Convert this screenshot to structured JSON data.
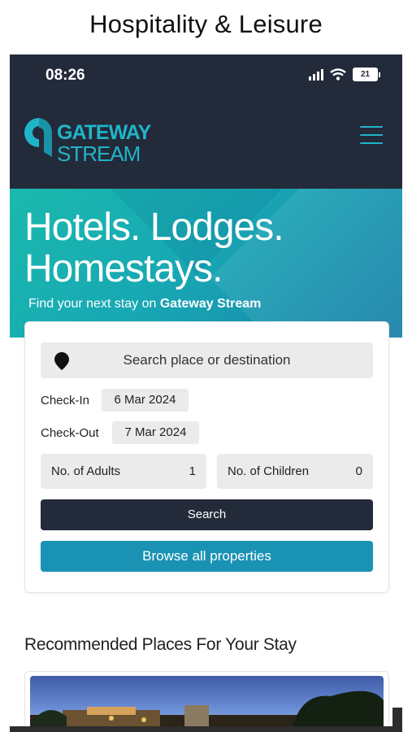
{
  "page_heading": "Hospitality & Leisure",
  "status_bar": {
    "time": "08:26",
    "battery": "21"
  },
  "brand": {
    "logo_line1": "GATEWAY",
    "logo_line2": "STREAM",
    "accent": "#1fb5c8",
    "dark": "#232a3a"
  },
  "hero": {
    "title_line1": "Hotels. Lodges.",
    "title_line2": "Homestays.",
    "subtitle_prefix": "Find your next stay on ",
    "subtitle_brand": "Gateway Stream"
  },
  "search_form": {
    "destination_placeholder": "Search place or destination",
    "checkin_label": "Check-In",
    "checkin_value": "6 Mar 2024",
    "checkout_label": "Check-Out",
    "checkout_value": "7 Mar 2024",
    "adults_label": "No. of Adults",
    "adults_value": "1",
    "children_label": "No. of Children",
    "children_value": "0",
    "search_button": "Search",
    "browse_button": "Browse all properties"
  },
  "recommended": {
    "title": "Recommended Places For Your Stay"
  },
  "icons": [
    "wifi-icon",
    "signal-icon",
    "battery-icon",
    "hamburger-menu-icon",
    "map-pin-icon",
    "logo-icon"
  ]
}
